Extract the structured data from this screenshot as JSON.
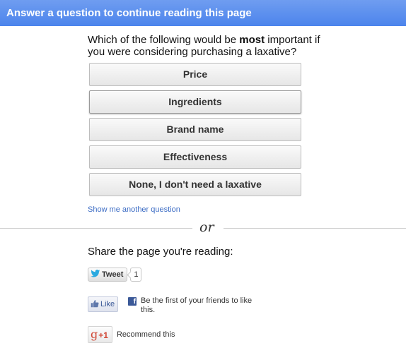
{
  "header": {
    "title": "Answer a question to continue reading this page"
  },
  "question": {
    "text_before": "Which of the following would be ",
    "text_bold": "most",
    "text_after": " important if you were considering purchasing a laxative?"
  },
  "answers": [
    {
      "label": "Price"
    },
    {
      "label": "Ingredients"
    },
    {
      "label": "Brand name"
    },
    {
      "label": "Effectiveness"
    },
    {
      "label": "None, I don't need a laxative"
    }
  ],
  "another_question_link": "Show me another question",
  "divider_text": "or",
  "share": {
    "title": "Share the page you're reading:",
    "tweet_label": "Tweet",
    "tweet_count": "1",
    "like_label": "Like",
    "like_text": "Be the first of your friends to like this.",
    "fb_icon_letter": "f",
    "gplus_g": "g",
    "gplus_label": "+1",
    "recommend_text": "Recommend this"
  },
  "colors": {
    "header_blue": "#4c84ec",
    "link_blue": "#3c6cc4",
    "facebook_blue": "#3b5998",
    "twitter_blue": "#2aa9e0",
    "gplus_red": "#d14836"
  }
}
